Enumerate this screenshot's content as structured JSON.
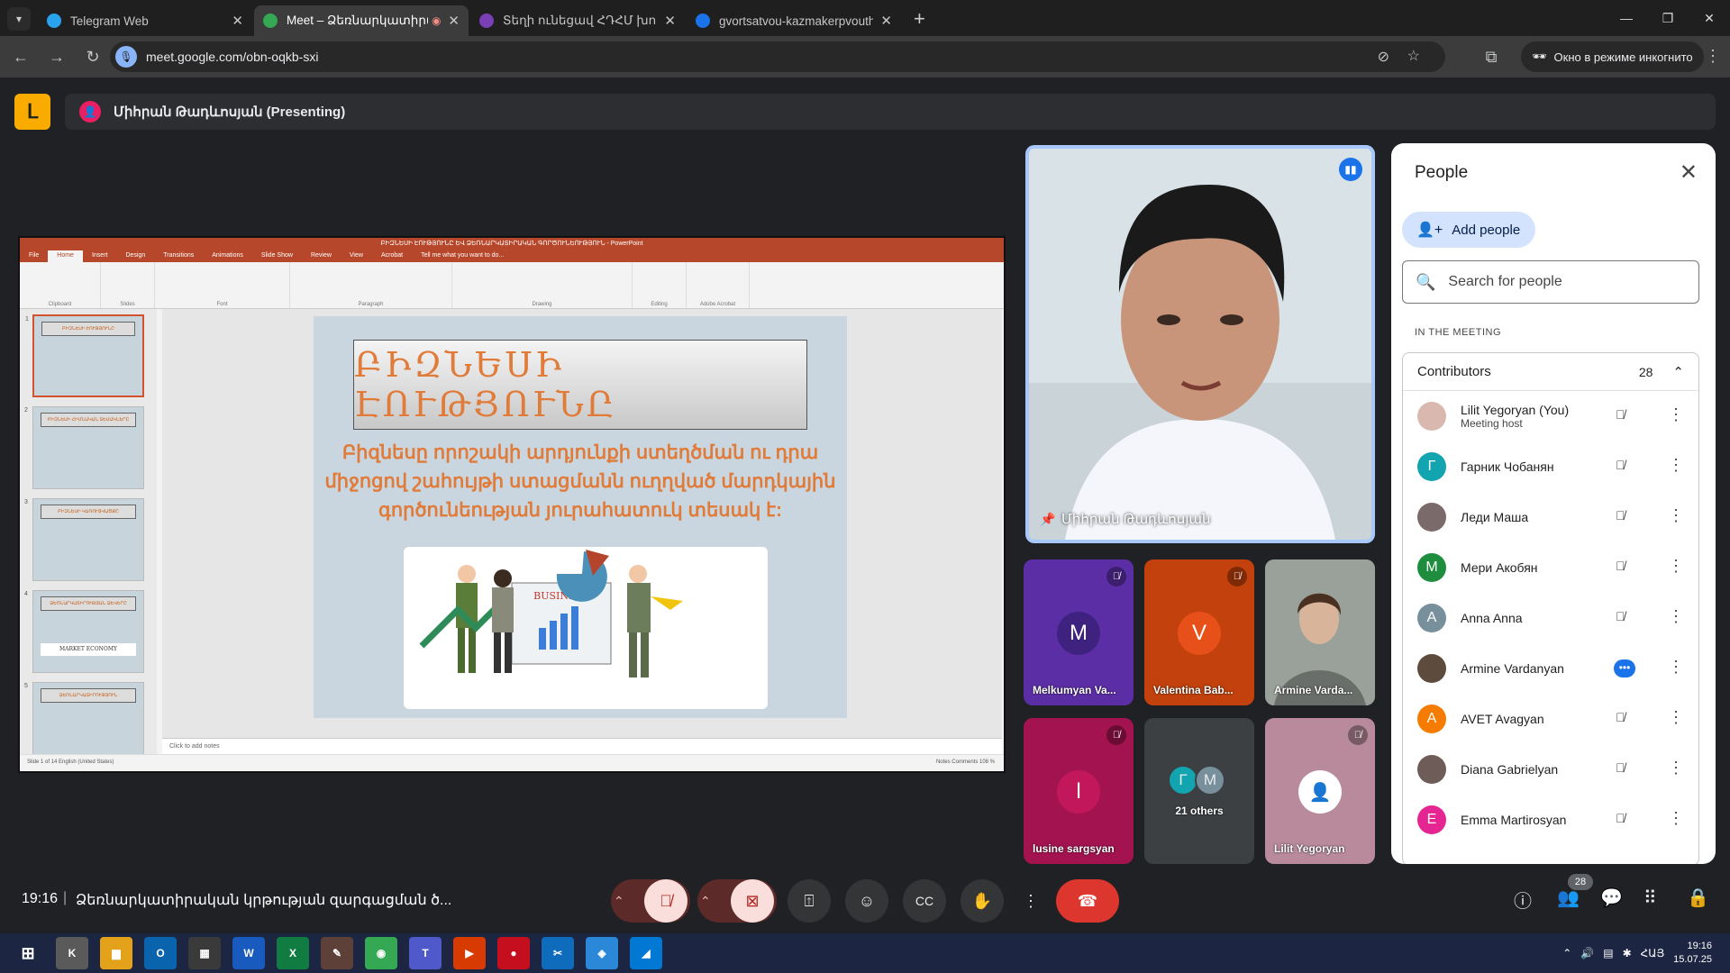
{
  "browser": {
    "tabs": [
      {
        "title": "Telegram Web",
        "color": "#2aa3ef",
        "icon": "telegram-icon"
      },
      {
        "title": "Meet – Ձեռնարկատիրակ",
        "color": "#34a853",
        "icon": "meet-icon"
      },
      {
        "title": "Տեղի ունեցավ ՀԴՀՄ խորհրդ",
        "color": "#7a3fb5",
        "icon": "site-icon"
      },
      {
        "title": "gvortsatvou-kazmakerpvouthyu",
        "color": "#1a73e8",
        "icon": "site-icon"
      }
    ],
    "url": "meet.google.com/obn-oqkb-sxi",
    "incognito_label": "Окно в режиме инкогнито"
  },
  "meet": {
    "presenter_label": "Միհրան Թադևոսյան (Presenting)",
    "speaker_name": "Միհրան Թադևոսյան",
    "tiles": [
      {
        "name": "Melkumyan Va...",
        "initial": "M",
        "bg": "#5b2ea6",
        "avatar": "#3f2280",
        "muted": true
      },
      {
        "name": "Valentina Bab...",
        "initial": "V",
        "bg": "#c2410c",
        "avatar": "#e8501a",
        "muted": true
      },
      {
        "name": "Armine Varda...",
        "initial": "",
        "bg": "#8a8f8a",
        "avatar": "",
        "muted": false
      },
      {
        "name": "lusine sargsyan",
        "initial": "l",
        "bg": "#a3134f",
        "avatar": "#c2185b",
        "muted": true
      },
      {
        "name": "21 others",
        "initial": "",
        "bg": "#3c4043",
        "avatar": "",
        "muted": false
      },
      {
        "name": "Lilit Yegoryan",
        "initial": "",
        "bg": "#b88a9c",
        "avatar": "",
        "muted": true
      }
    ],
    "others_initials": [
      "Г",
      "M"
    ],
    "clock": "19:16",
    "meeting_title": "Ձեռնարկատիրական կրթության զարգացման ծ...",
    "people_count": "28"
  },
  "ppt": {
    "window_title": "ԲԻԶՆԵՍԻ ԷՈՒԹՅՈՒՆԸ ԵՎ ՁԵՌՆԱՐԿԱՏԻՐԱԿԱՆ ԳՈՐԾՈՒՆԵՈՒԹՅՈՒՆ - PowerPoint",
    "tabs": [
      "File",
      "Home",
      "Insert",
      "Design",
      "Transitions",
      "Animations",
      "Slide Show",
      "Review",
      "View",
      "Acrobat",
      "Tell me what you want to do..."
    ],
    "ribbon_groups": [
      "Clipboard",
      "Slides",
      "Font",
      "Paragraph",
      "Drawing",
      "Editing",
      "Adobe Acrobat"
    ],
    "slide_title": "ԲԻԶՆԵՍԻ ԷՈՒԹՅՈՒՆԸ",
    "slide_body": "Բիզնեսը որոշակի արդյունքի ստեղծման ու դրա միջոցով շահույթի ստացմանն ուղղված մարդկային գործունեության յուրահատուկ տեսակ է:",
    "business_label": "BUSINESS",
    "market_label": "MARKET ECONOMY",
    "notes_placeholder": "Click to add notes",
    "status_text": "Slide 1 of 14    English (United States)",
    "status_right": "Notes   Comments      108 %",
    "thumb_numbers": [
      "1",
      "2",
      "3",
      "4",
      "5"
    ],
    "thumb_titles": [
      "ԲԻԶՆԵՍԻ ԷՈՒԹՅՈՒՆԸ",
      "ԲԻԶՆԵՍԻ ՀԻՄՆԱԿԱՆ ՏԵՍԱԿՆԵՐԸ",
      "ԲԻԶՆԵՍԻ ԿԱՌՈՒՑՎԱԾՔԸ",
      "ՁԵՌՆԱՐԿԱՏԻՐՈՒԹՅԱՆ ՁԵՎԵՐԸ",
      "ՁԵՌՆԱՐԿԱՏԻՐՈՒԹՅՈՒՆ"
    ]
  },
  "people_panel": {
    "title": "People",
    "add_label": "Add people",
    "search_placeholder": "Search for people",
    "section_label": "IN THE MEETING",
    "group_label": "Contributors",
    "group_count": "28",
    "rows": [
      {
        "name": "Lilit Yegoryan (You)",
        "sub": "Meeting host",
        "initial": "",
        "color": "#d9b8b0",
        "state": "muted"
      },
      {
        "name": "Гарник Чобанян",
        "sub": "",
        "initial": "Г",
        "color": "#12a4af",
        "state": "muted"
      },
      {
        "name": "Леди Маша",
        "sub": "",
        "initial": "",
        "color": "#7a6a6a",
        "state": "muted"
      },
      {
        "name": "Мери Акобян",
        "sub": "",
        "initial": "M",
        "color": "#1e8e3e",
        "state": "muted"
      },
      {
        "name": "Anna Anna",
        "sub": "",
        "initial": "A",
        "color": "#78909c",
        "state": "muted"
      },
      {
        "name": "Armine Vardanyan",
        "sub": "",
        "initial": "",
        "color": "#5d4b3e",
        "state": "speaking"
      },
      {
        "name": "AVET Avagyan",
        "sub": "",
        "initial": "A",
        "color": "#f57c00",
        "state": "muted"
      },
      {
        "name": "Diana Gabrielyan",
        "sub": "",
        "initial": "",
        "color": "#6d5c58",
        "state": "muted"
      },
      {
        "name": "Emma Martirosyan",
        "sub": "",
        "initial": "E",
        "color": "#e52592",
        "state": "muted"
      }
    ]
  },
  "taskbar": {
    "apps": [
      {
        "label": "⊞",
        "color": "#1c2541",
        "icon": "windows-start-icon"
      },
      {
        "label": "K",
        "color": "#5a5a5a",
        "icon": "app-icon"
      },
      {
        "label": "▆",
        "color": "#e3a21a",
        "icon": "file-explorer-icon"
      },
      {
        "label": "O",
        "color": "#0a64ad",
        "icon": "outlook-icon"
      },
      {
        "label": "▦",
        "color": "#3a3a3a",
        "icon": "calculator-icon"
      },
      {
        "label": "W",
        "color": "#185abd",
        "icon": "word-icon"
      },
      {
        "label": "X",
        "color": "#107c41",
        "icon": "excel-icon"
      },
      {
        "label": "✎",
        "color": "#5d4037",
        "icon": "paint-icon"
      },
      {
        "label": "◉",
        "color": "#34a853",
        "icon": "chrome-icon"
      },
      {
        "label": "T",
        "color": "#5059c9",
        "icon": "teams-icon"
      },
      {
        "label": "▶",
        "color": "#d83b01",
        "icon": "anydesk-icon"
      },
      {
        "label": "●",
        "color": "#c50f1f",
        "icon": "record-icon"
      },
      {
        "label": "✂",
        "color": "#0f6cbd",
        "icon": "snipping-icon"
      },
      {
        "label": "◈",
        "color": "#2b88d8",
        "icon": "app-icon"
      },
      {
        "label": "◢",
        "color": "#0078d4",
        "icon": "photos-icon"
      }
    ],
    "lang": "ՀԱՅ",
    "time": "19:16",
    "date": "15.07.25"
  }
}
